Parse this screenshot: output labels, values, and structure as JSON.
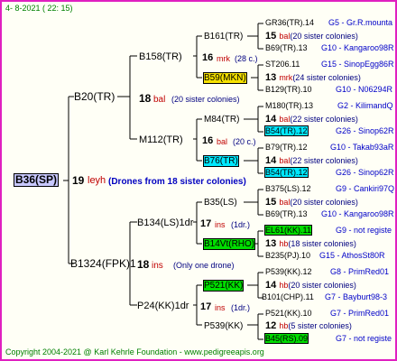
{
  "header": {
    "date": "4-  8-2021 (  22:  15)"
  },
  "footer": {
    "copyright": "Copyright 2004-2021 @ Karl Kehrle Foundation",
    "site": "www.pedigreeapis.org"
  },
  "root": {
    "name": "B36(SP)",
    "num": "19",
    "code": "leyh",
    "note": "(Drones from 18 sister colonies)"
  },
  "gen1": [
    {
      "name": "B20(TR)",
      "num": "18",
      "code": "bal",
      "note": "(20 sister colonies)"
    },
    {
      "name": "B1324(FPK)1",
      "num": "18",
      "code": "ins",
      "note": "(Only one drone)"
    }
  ],
  "gen2": [
    {
      "name": "B158(TR)",
      "num": "16",
      "code": "mrk",
      "note": "(28 c.)"
    },
    {
      "name": "M112(TR)",
      "num": "16",
      "code": "bal",
      "note": "(20 c.)"
    },
    {
      "name": "B134(LS)1dr",
      "num": "17",
      "code": "ins",
      "note": "(1dr.)"
    },
    {
      "name": "P24(KK)1dr",
      "num": "17",
      "code": "ins",
      "note": "(1dr.)"
    }
  ],
  "gen3": [
    {
      "name": "B161(TR)",
      "num": "15",
      "code": "bal",
      "note": "(20 sister colonies)"
    },
    {
      "name": "B59(MKN)",
      "num": "13",
      "code": "mrk",
      "note": "(24 sister colonies)"
    },
    {
      "name": "M84(TR)",
      "num": "14",
      "code": "bal",
      "note": "(22 sister colonies)"
    },
    {
      "name": "B76(TR)",
      "num": "14",
      "code": "bal",
      "note": "(22 sister colonies)"
    },
    {
      "name": "B35(LS)",
      "num": "15",
      "code": "bal",
      "note": "(20 sister colonies)"
    },
    {
      "name": "B14Vt(RHO)",
      "num": "13",
      "code": "hb",
      "note": "(18 sister colonies)"
    },
    {
      "name": "P521(KK)",
      "num": "14",
      "code": "hb",
      "note": "(20 sister colonies)"
    },
    {
      "name": "P539(KK)",
      "num": "12",
      "code": "hb",
      "note": "(5 sister colonies)"
    }
  ],
  "gen4": [
    {
      "name": "GR36(TR).14",
      "info": "G5 - Gr.R.mounta"
    },
    {
      "name": "B69(TR).13",
      "info": "G10 - Kangaroo98R"
    },
    {
      "name": "ST206.11",
      "info": "G15 - SinopEgg86R"
    },
    {
      "name": "B129(TR).10",
      "info": "G10 - N06294R"
    },
    {
      "name": "M180(TR).13",
      "info": "G2 - KilimandQ"
    },
    {
      "name": "B54(TR).12",
      "info": "G26 - Sinop62R"
    },
    {
      "name": "B79(TR).12",
      "info": "G10 - Takab93aR"
    },
    {
      "name": "B54(TR).12",
      "info": "G26 - Sinop62R"
    },
    {
      "name": "B375(LS).12",
      "info": "G9 - Cankiri97Q"
    },
    {
      "name": "B69(TR).13",
      "info": "G10 - Kangaroo98R"
    },
    {
      "name": "EL61(KK).11",
      "info": "G9 - not registe"
    },
    {
      "name": "B235(PJ).10",
      "info": "G15 - AthosSt80R"
    },
    {
      "name": "P539(KK).12",
      "info": "G8 - PrimRed01"
    },
    {
      "name": "B101(CHP).11",
      "info": "G7 - Bayburt98-3"
    },
    {
      "name": "P521(KK).10",
      "info": "G7 - PrimRed01"
    },
    {
      "name": "B45(RS).09",
      "info": "G7 - not registe"
    }
  ],
  "colors": {
    "border": "#e020c0",
    "highlight_yellow": "#f5e000",
    "highlight_cyan": "#00e8ff",
    "highlight_green": "#00dd00"
  }
}
